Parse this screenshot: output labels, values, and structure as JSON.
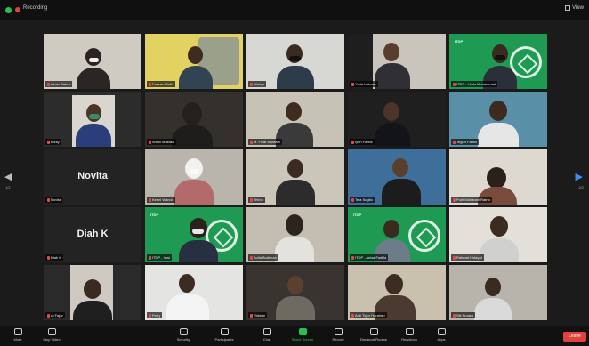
{
  "topbar": {
    "recording_label": "Recording",
    "view_label": "View"
  },
  "nav": {
    "prev": "◀",
    "next": "▶",
    "page_left": "1/2",
    "page_right": "2/2"
  },
  "tiles": [
    {
      "id": "t01",
      "name": "Ainun Zahra"
    },
    {
      "id": "t02",
      "name": "Fauzan Galih",
      "active": true
    },
    {
      "id": "t03",
      "name": "Wahyu"
    },
    {
      "id": "t04",
      "name": "Yuda Lukman"
    },
    {
      "id": "t05",
      "name": "ITDP - Haris Muhammad"
    },
    {
      "id": "t06",
      "name": "Rizky"
    },
    {
      "id": "t07",
      "name": "Widhi Mustika"
    },
    {
      "id": "t08",
      "name": "M. Fikar Mustafa"
    },
    {
      "id": "t09",
      "name": "Iyon Fadhil"
    },
    {
      "id": "t10",
      "name": "Teguh Fadhil"
    },
    {
      "id": "t11",
      "name": "Novita",
      "display_name": "Novita"
    },
    {
      "id": "t12",
      "name": "Kirani Wanda"
    },
    {
      "id": "t13",
      "name": "Tekno"
    },
    {
      "id": "t14",
      "name": "Teja Sugito"
    },
    {
      "id": "t15",
      "name": "Putri Maharani Ratno"
    },
    {
      "id": "t16",
      "name": "Diah K",
      "display_name": "Diah K"
    },
    {
      "id": "t17",
      "name": "ITDP - Yosi"
    },
    {
      "id": "t18",
      "name": "Aulia Budiman"
    },
    {
      "id": "t19",
      "name": "ITDP - Anisa Fadilla"
    },
    {
      "id": "t20",
      "name": "Rahmat Hidayat"
    },
    {
      "id": "t21",
      "name": "Al Fajar"
    },
    {
      "id": "t22",
      "name": "Ferry"
    },
    {
      "id": "t23",
      "name": "Ridwan"
    },
    {
      "id": "t24",
      "name": "Ardi Tigor Harahap"
    },
    {
      "id": "t25",
      "name": "Siti Nuraini"
    }
  ],
  "toolbar": {
    "items": [
      {
        "id": "mute",
        "label": "Mute"
      },
      {
        "id": "video",
        "label": "Stop Video"
      },
      {
        "id": "security",
        "label": "Security"
      },
      {
        "id": "participants",
        "label": "Participants"
      },
      {
        "id": "chat",
        "label": "Chat"
      },
      {
        "id": "share",
        "label": "Share Screen"
      },
      {
        "id": "record",
        "label": "Record"
      },
      {
        "id": "breakout",
        "label": "Breakout Rooms"
      },
      {
        "id": "reactions",
        "label": "Reactions"
      },
      {
        "id": "apps",
        "label": "Apps"
      }
    ],
    "leave": "Leave"
  },
  "colors": {
    "accent": "#23c552",
    "brand_green": "#1e9a53",
    "leave": "#e0433b",
    "active_speaker": "#f1d61d"
  }
}
